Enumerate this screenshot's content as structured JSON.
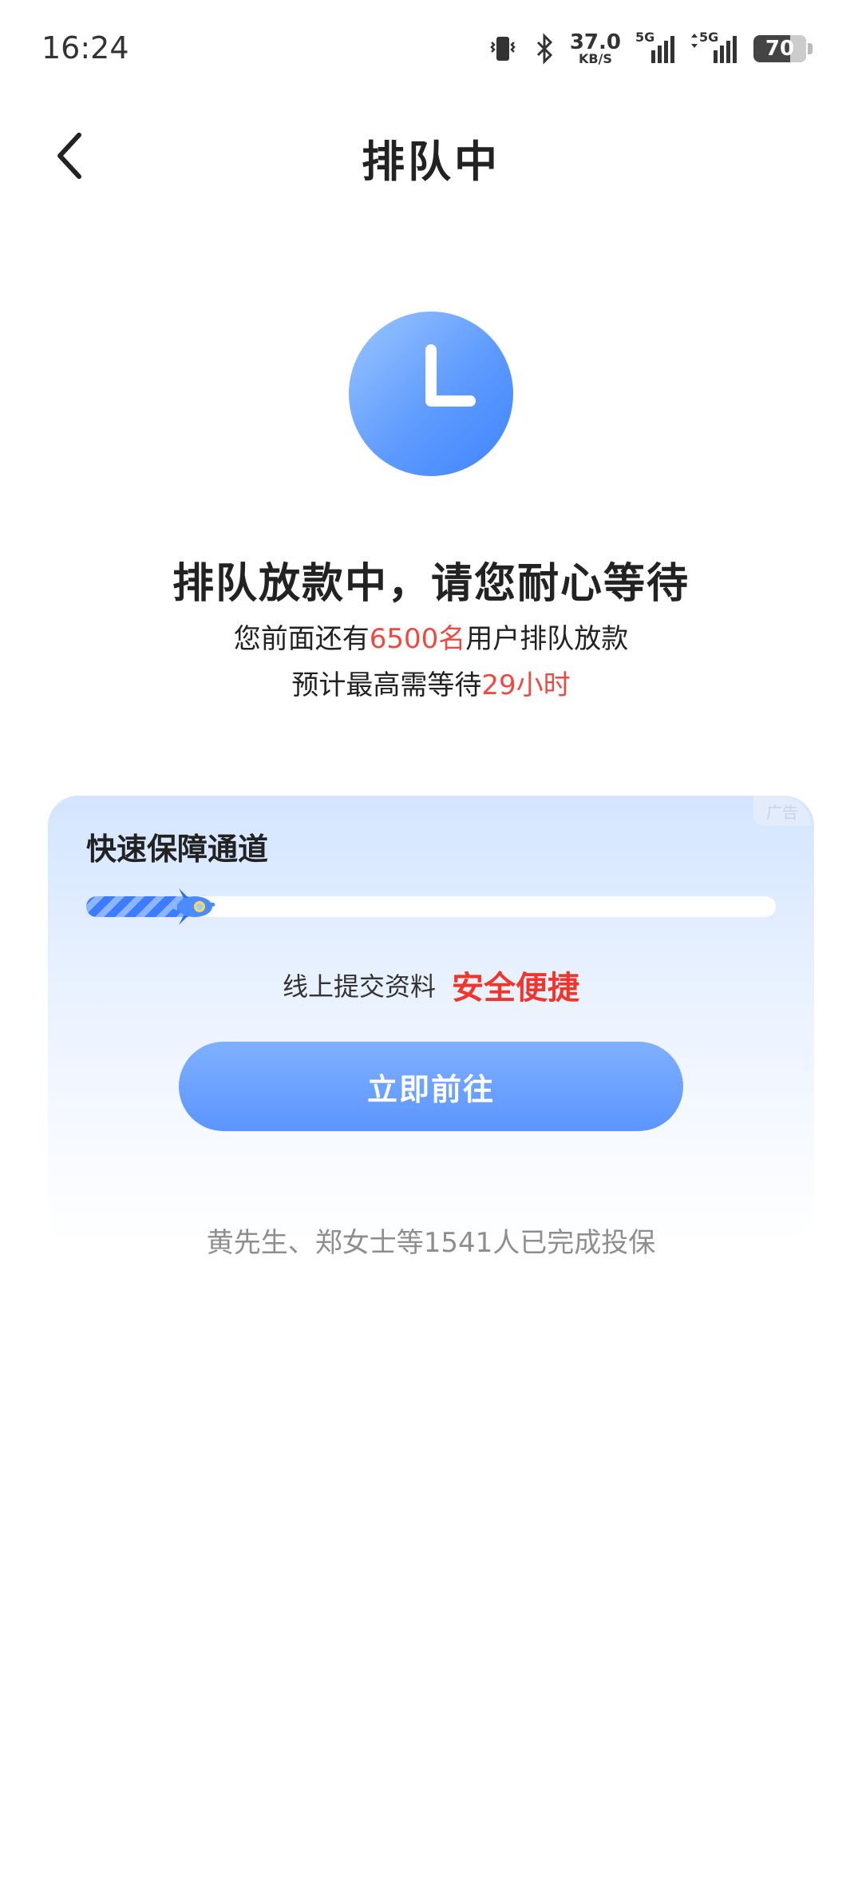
{
  "status_bar": {
    "time": "16:24",
    "net_speed_value": "37.0",
    "net_speed_unit": "KB/S",
    "sim1_label": "5G",
    "sim2_label": "5G",
    "battery_percent": "70"
  },
  "header": {
    "title": "排队中"
  },
  "queue": {
    "headline": "排队放款中，请您耐心等待",
    "line1_prefix": "您前面还有",
    "line1_count": "6500名",
    "line1_suffix": "用户排队放款",
    "line2_prefix": "预计最高需等待",
    "line2_time": "29小时",
    "highlight_color": "#ef4a3f"
  },
  "promo_card": {
    "ad_badge": "广告",
    "title": "快速保障通道",
    "progress_fraction": 0.16,
    "tag_plain": "线上提交资料",
    "tag_strong": "安全便捷",
    "cta_label": "立即前往",
    "accent_color": "#4a8bff"
  },
  "footnote": "黄先生、郑女士等1541人已完成投保"
}
